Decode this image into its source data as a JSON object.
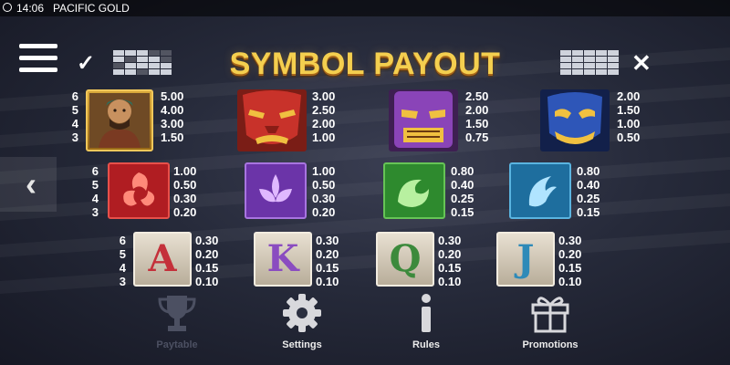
{
  "topbar": {
    "time": "14:06",
    "game_name": "PACIFIC GOLD"
  },
  "title": "SYMBOL PAYOUT",
  "colors": {
    "title": "#f4cf4f",
    "background": "#262a3a",
    "inactive_nav": "#4c5062"
  },
  "payout_rows": [
    {
      "counts": [
        "6",
        "5",
        "4",
        "3"
      ],
      "symbols": [
        {
          "name": "warrior",
          "payouts": [
            "5.00",
            "4.00",
            "3.00",
            "1.50"
          ]
        },
        {
          "name": "red-mask",
          "payouts": [
            "3.00",
            "2.50",
            "2.00",
            "1.00"
          ]
        },
        {
          "name": "purple-mask",
          "payouts": [
            "2.50",
            "2.00",
            "1.50",
            "0.75"
          ]
        },
        {
          "name": "blue-mask",
          "payouts": [
            "2.00",
            "1.50",
            "1.00",
            "0.50"
          ]
        }
      ]
    },
    {
      "counts": [
        "6",
        "5",
        "4",
        "3"
      ],
      "symbols": [
        {
          "name": "red-triskele",
          "payouts": [
            "1.00",
            "0.50",
            "0.30",
            "0.20"
          ]
        },
        {
          "name": "purple-flower",
          "payouts": [
            "1.00",
            "0.50",
            "0.30",
            "0.20"
          ]
        },
        {
          "name": "green-wave",
          "payouts": [
            "0.80",
            "0.40",
            "0.25",
            "0.15"
          ]
        },
        {
          "name": "blue-hook",
          "payouts": [
            "0.80",
            "0.40",
            "0.25",
            "0.15"
          ]
        }
      ]
    },
    {
      "counts": [
        "6",
        "5",
        "4",
        "3"
      ],
      "symbols": [
        {
          "name": "A",
          "letter": "A",
          "payouts": [
            "0.30",
            "0.20",
            "0.15",
            "0.10"
          ]
        },
        {
          "name": "K",
          "letter": "K",
          "payouts": [
            "0.30",
            "0.20",
            "0.15",
            "0.10"
          ]
        },
        {
          "name": "Q",
          "letter": "Q",
          "payouts": [
            "0.30",
            "0.20",
            "0.15",
            "0.10"
          ]
        },
        {
          "name": "J",
          "letter": "J",
          "payouts": [
            "0.30",
            "0.20",
            "0.15",
            "0.10"
          ]
        }
      ]
    }
  ],
  "nav": [
    {
      "label": "Paytable",
      "icon": "trophy-icon",
      "active": true
    },
    {
      "label": "Settings",
      "icon": "gear-icon",
      "active": false
    },
    {
      "label": "Rules",
      "icon": "info-icon",
      "active": false
    },
    {
      "label": "Promotions",
      "icon": "gift-icon",
      "active": false
    }
  ]
}
